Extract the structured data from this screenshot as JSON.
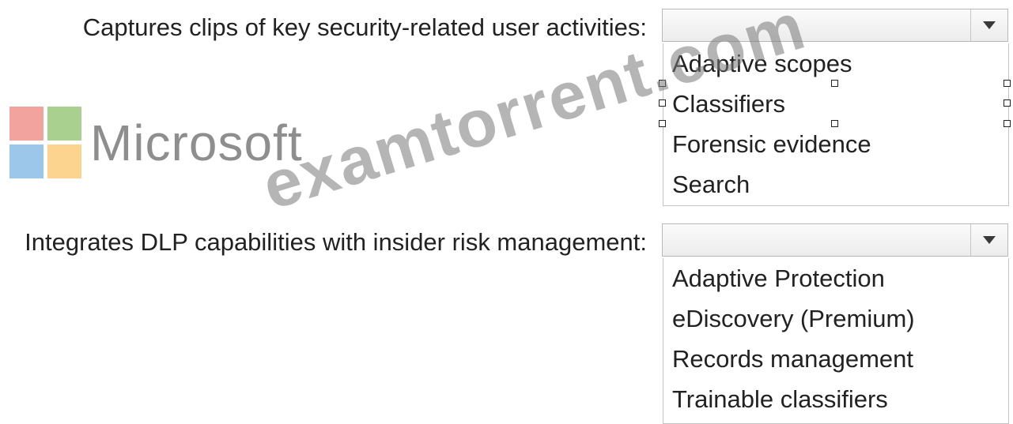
{
  "questions": [
    {
      "label": "Captures clips of key security-related user activities:",
      "options": [
        "Adaptive scopes",
        "Classifiers",
        "Forensic evidence",
        "Search"
      ]
    },
    {
      "label": "Integrates DLP capabilities with insider risk management:",
      "options": [
        "Adaptive Protection",
        "eDiscovery (Premium)",
        "Records management",
        "Trainable classifiers"
      ]
    }
  ],
  "logo": {
    "text": "Microsoft",
    "colors": [
      "#f2a39d",
      "#a9d08e",
      "#9cc6ea",
      "#fcd490"
    ]
  },
  "watermark": "examtorrent.com",
  "icons": {
    "dropdown": "chevron-down-icon",
    "selection": "resize-handle-icon"
  }
}
